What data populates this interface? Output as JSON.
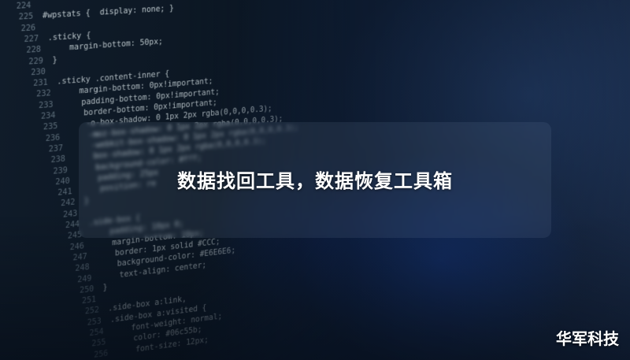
{
  "image": {
    "code_lines": [
      {
        "num": "224",
        "text": ""
      },
      {
        "num": "225",
        "text": "#wpstats {  display: none; }"
      },
      {
        "num": "226",
        "text": ""
      },
      {
        "num": "227",
        "text": ".sticky {"
      },
      {
        "num": "228",
        "text": "    margin-bottom: 50px;"
      },
      {
        "num": "229",
        "text": "}"
      },
      {
        "num": "230",
        "text": ""
      },
      {
        "num": "231",
        "text": ".sticky .content-inner {"
      },
      {
        "num": "232",
        "text": "    margin-bottom: 0px!important;"
      },
      {
        "num": "233",
        "text": "    padding-bottom: 0px!important;"
      },
      {
        "num": "234",
        "text": "    border-bottom: 0px!important;"
      },
      {
        "num": "235",
        "text": "    -o-box-shadow: 0 1px 2px rgba(0,0,0,0.3);"
      },
      {
        "num": "236",
        "text": "    -moz-box-shadow: 0 1px 2px rgba(0,0,0,0.3);"
      },
      {
        "num": "237",
        "text": "    -webkit-box-shadow: 0 1px 2px rgba(0,0,0,0.3);"
      },
      {
        "num": "238",
        "text": "    box-shadow: 0 1px 2px rgba(0,0,0,0.3);"
      },
      {
        "num": "239",
        "text": "    background-color: #fff;"
      },
      {
        "num": "240",
        "text": "    padding: 25px"
      },
      {
        "num": "241",
        "text": "    position: re"
      },
      {
        "num": "242",
        "text": "}"
      },
      {
        "num": "243",
        "text": ""
      },
      {
        "num": "244",
        "text": ".side-box {"
      },
      {
        "num": "245",
        "text": "    padding: 10px 0;"
      },
      {
        "num": "246",
        "text": "    margin-bottom: 10px;"
      },
      {
        "num": "247",
        "text": "    border: 1px solid #CCC;"
      },
      {
        "num": "248",
        "text": "    background-color: #E6E6E6;"
      },
      {
        "num": "249",
        "text": "    text-align: center;"
      },
      {
        "num": "250",
        "text": "}"
      },
      {
        "num": "251",
        "text": ""
      },
      {
        "num": "252",
        "text": ".side-box a:link,"
      },
      {
        "num": "253",
        "text": ".side-box a:visited {"
      },
      {
        "num": "254",
        "text": "    font-weight: normal;"
      },
      {
        "num": "255",
        "text": "    color: #06c55b;"
      },
      {
        "num": "256",
        "text": "    font-size: 12px;"
      }
    ]
  },
  "overlay": {
    "title": "数据找回工具，数据恢复工具箱"
  },
  "watermark": {
    "text": "华军科技"
  }
}
